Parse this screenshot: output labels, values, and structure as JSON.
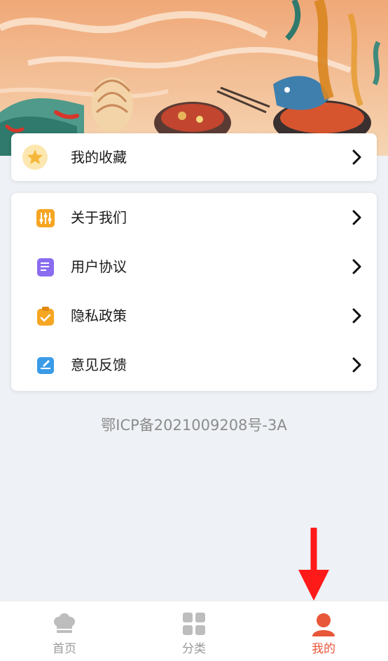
{
  "favorites": {
    "label": "我的收藏",
    "icon": "star-icon"
  },
  "menu": [
    {
      "label": "关于我们",
      "icon": "sliders-icon"
    },
    {
      "label": "用户协议",
      "icon": "document-icon"
    },
    {
      "label": "隐私政策",
      "icon": "clipboard-check-icon"
    },
    {
      "label": "意见反馈",
      "icon": "feedback-edit-icon"
    }
  ],
  "footer": {
    "icp": "鄂ICP备2021009208号-3A"
  },
  "tabbar": {
    "tabs": [
      {
        "label": "首页",
        "icon": "chef-hat-icon",
        "active": false
      },
      {
        "label": "分类",
        "icon": "grid-icon",
        "active": false
      },
      {
        "label": "我的",
        "icon": "user-icon",
        "active": true
      }
    ]
  },
  "colors": {
    "accent": "#e8573a",
    "inactive": "#9a9a9a",
    "background": "#eef1f5"
  }
}
